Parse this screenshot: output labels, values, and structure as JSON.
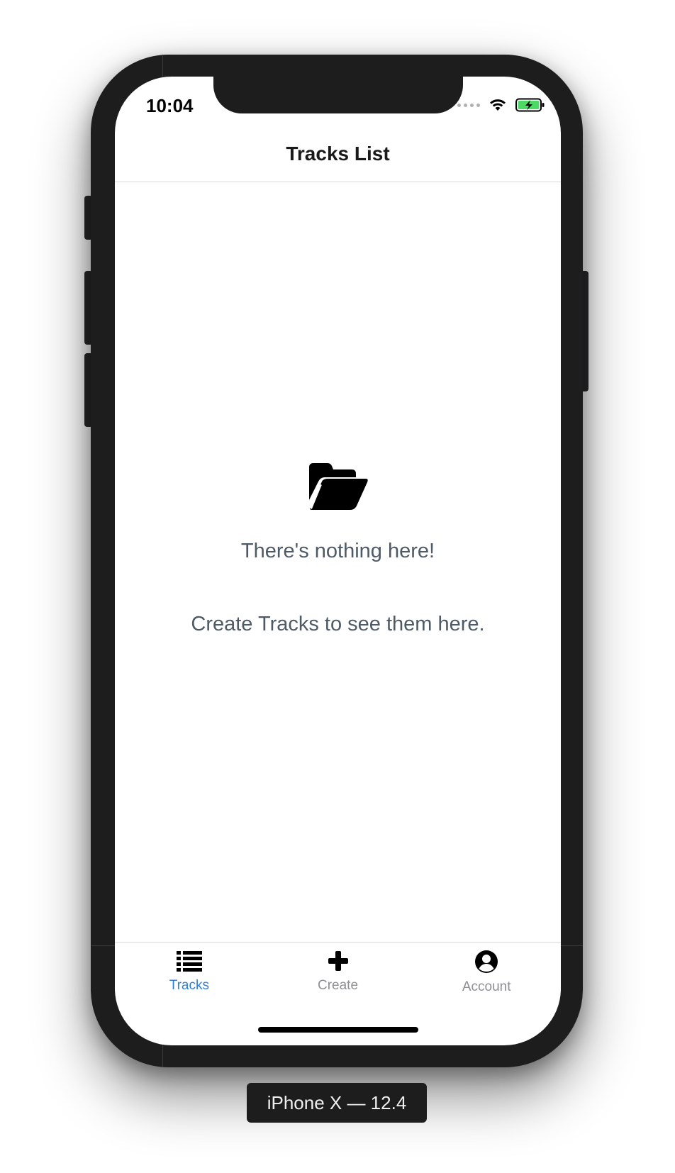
{
  "status_bar": {
    "time": "10:04",
    "battery_color": "#4cd964"
  },
  "header": {
    "title": "Tracks List"
  },
  "empty_state": {
    "icon": "folder-open-icon",
    "title": "There's nothing here!",
    "subtitle": "Create Tracks to see them here."
  },
  "tabbar": {
    "active_color": "#2f7fd8",
    "inactive_color": "#8e8e93",
    "tabs": [
      {
        "label": "Tracks",
        "icon": "list-icon",
        "active": true
      },
      {
        "label": "Create",
        "icon": "plus-icon",
        "active": false
      },
      {
        "label": "Account",
        "icon": "user-circle-icon",
        "active": false
      }
    ]
  },
  "simulator": {
    "device_label": "iPhone X — 12.4"
  }
}
